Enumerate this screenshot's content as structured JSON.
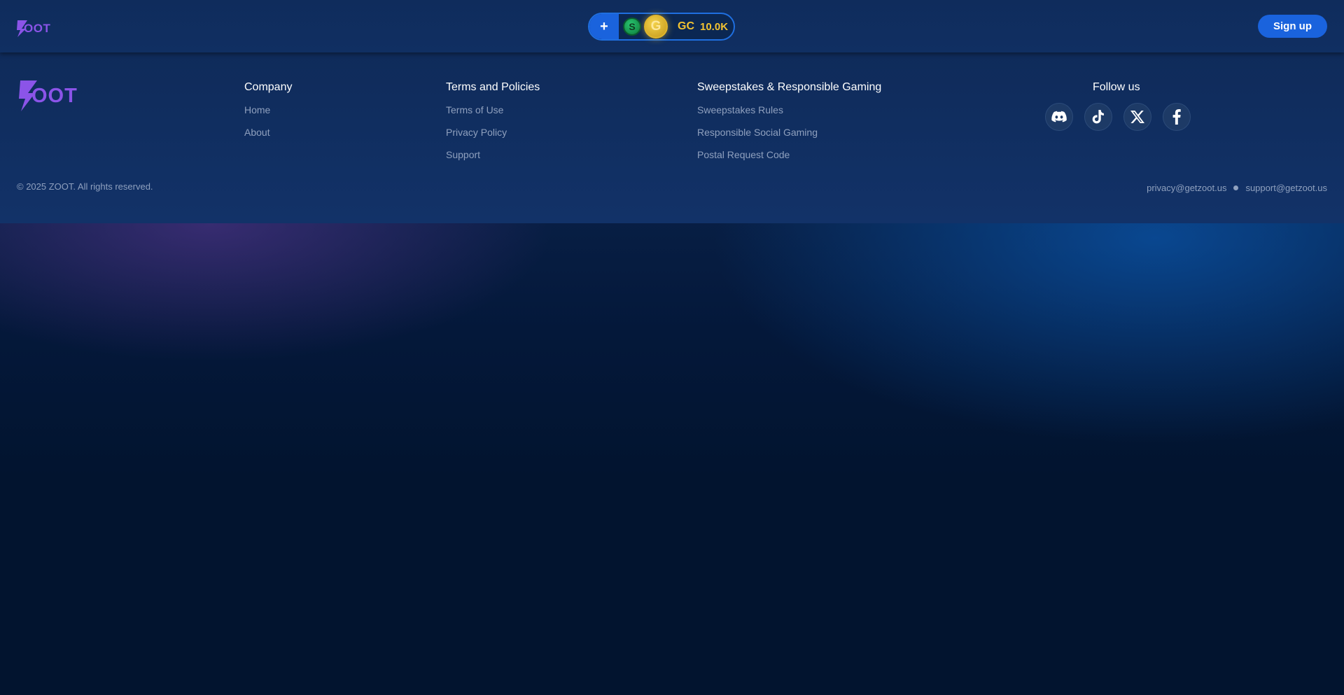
{
  "brand": {
    "name": "ZOOT",
    "color": "#8b54e8"
  },
  "header": {
    "wallet": {
      "add_label": "+",
      "sc_coin_letter": "S",
      "gc_coin_letter": "G",
      "currency_label": "GC",
      "balance": "10.0K"
    },
    "signup_label": "Sign up"
  },
  "footer": {
    "columns": [
      {
        "title": "Company",
        "links": [
          "Home",
          "About"
        ]
      },
      {
        "title": "Terms and Policies",
        "links": [
          "Terms of Use",
          "Privacy Policy",
          "Support"
        ]
      },
      {
        "title": "Sweepstakes & Responsible Gaming",
        "links": [
          "Sweepstakes Rules",
          "Responsible Social Gaming",
          "Postal Request Code"
        ]
      }
    ],
    "follow_title": "Follow us",
    "socials": [
      "discord-icon",
      "tiktok-icon",
      "x-icon",
      "facebook-icon"
    ],
    "copyright": "© 2025 ZOOT. All rights reserved.",
    "emails": [
      "privacy@getzoot.us",
      "support@getzoot.us"
    ]
  },
  "colors": {
    "accent_blue": "#1a63dd",
    "gold": "#f3c331",
    "link_gray": "#8fa0be",
    "footer_bg": "#10305f",
    "page_bg": "#02142f"
  }
}
